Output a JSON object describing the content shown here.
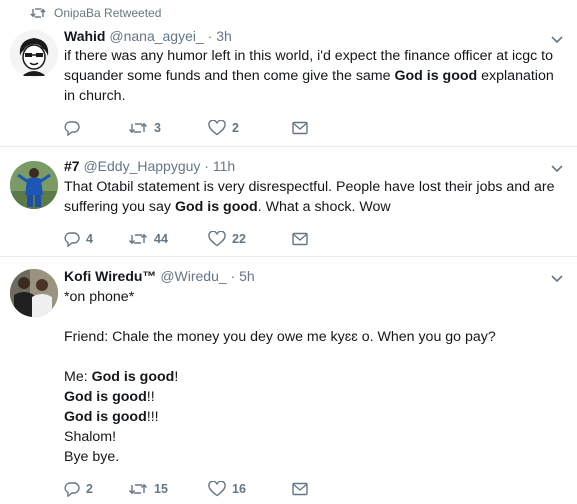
{
  "retweet_banner": {
    "text": "OnipaBa Retweeted"
  },
  "tweets": [
    {
      "name": "Wahid",
      "handle": "@nana_agyei_",
      "sep": " · ",
      "time": "3h",
      "text_parts": [
        {
          "t": "if there was any humor left in this world, i'd expect the finance officer at icgc to squander some funds and then come give the same ",
          "b": false
        },
        {
          "t": "God is good",
          "b": true
        },
        {
          "t": " explanation in church.",
          "b": false
        }
      ],
      "replies": "",
      "retweets": "3",
      "likes": "2"
    },
    {
      "name": "#7",
      "handle": "@Eddy_Happyguy",
      "sep": " · ",
      "time": "11h",
      "text_parts": [
        {
          "t": "That Otabil statement is very disrespectful. People have lost their jobs and are suffering you say ",
          "b": false
        },
        {
          "t": "God is good",
          "b": true
        },
        {
          "t": ". What a shock. Wow",
          "b": false
        }
      ],
      "replies": "4",
      "retweets": "44",
      "likes": "22"
    },
    {
      "name": "Kofi Wiredu™",
      "handle": "@Wiredu_",
      "sep": " · ",
      "time": "5h",
      "text_parts": [
        {
          "t": "*on phone*\n\nFriend: Chale the money you dey owe me kyɛɛ o. When you go pay?\n\nMe: ",
          "b": false
        },
        {
          "t": "God is good",
          "b": true
        },
        {
          "t": "!\n",
          "b": false
        },
        {
          "t": "God is good",
          "b": true
        },
        {
          "t": "!!\n",
          "b": false
        },
        {
          "t": "God is good",
          "b": true
        },
        {
          "t": "!!!\nShalom!\nBye bye.",
          "b": false
        }
      ],
      "replies": "2",
      "retweets": "15",
      "likes": "16"
    }
  ],
  "icons": {
    "retweet_banner": "retweet-icon",
    "caret": "chevron-down-icon",
    "reply": "reply-icon",
    "retweet": "retweet-icon",
    "like": "heart-icon",
    "dm": "envelope-icon"
  },
  "colors": {
    "secondary_text": "#657786",
    "primary_text": "#14171a",
    "divider": "#e6ecf0"
  }
}
